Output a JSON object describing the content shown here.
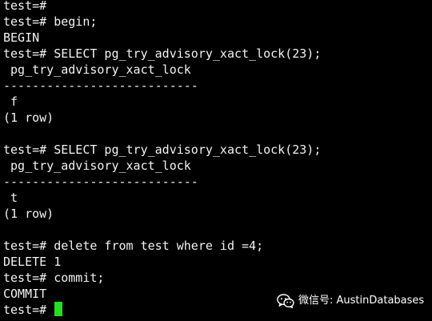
{
  "terminal": {
    "lines": [
      "test=#",
      "test=# begin;",
      "BEGIN",
      "test=# SELECT pg_try_advisory_xact_lock(23);",
      " pg_try_advisory_xact_lock",
      "---------------------------",
      " f",
      "(1 row)",
      "",
      "test=# SELECT pg_try_advisory_xact_lock(23);",
      " pg_try_advisory_xact_lock",
      "---------------------------",
      " t",
      "(1 row)",
      "",
      "test=# delete from test where id =4;",
      "DELETE 1",
      "test=# commit;",
      "COMMIT"
    ],
    "prompt": "test=# ",
    "cursor_color": "#22e01f"
  },
  "watermark": {
    "icon": "wechat-icon",
    "text": "微信号: AustinDatabases"
  }
}
